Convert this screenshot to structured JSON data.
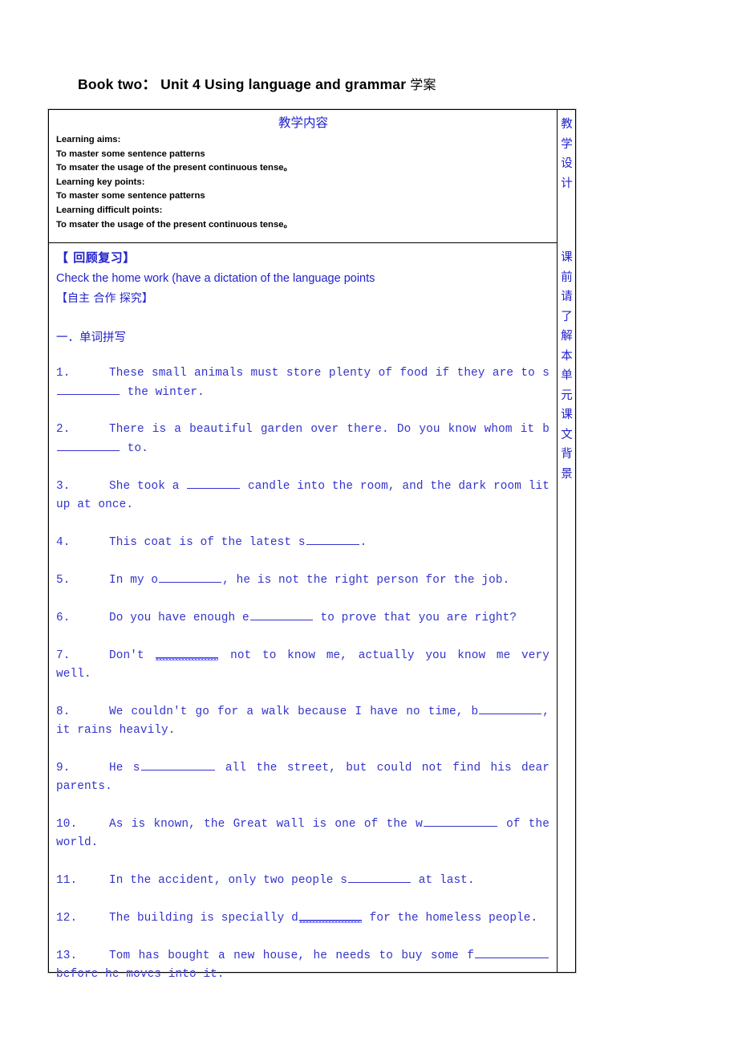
{
  "document": {
    "title_en": "Book two： Unit 4   Using language and grammar ",
    "title_cn": "学案"
  },
  "table": {
    "header_cell": {
      "heading": "教学内容",
      "lines": [
        "Learning aims:",
        "To master some sentence patterns",
        "To msater the usage of the present continuous tense。",
        "Learning key points:",
        "To master some sentence patterns",
        "Learning difficult points:",
        "To msater the usage of the present continuous tense。"
      ]
    },
    "body_cell": {
      "review_heading": "【 回顾复习】",
      "review_task": "Check the home work (have a dictation of the language points",
      "method_bracket": "【自主  合作  探究】",
      "section_heading": "一．单词拼写",
      "items": [
        {
          "num": "1.",
          "parts": [
            {
              "t": "text",
              "v": "These small animals must store plenty of food if they are to s"
            },
            {
              "t": "blank",
              "w": "md"
            },
            {
              "t": "text",
              "v": " the winter."
            }
          ]
        },
        {
          "num": "2.",
          "parts": [
            {
              "t": "text",
              "v": "There is a beautiful garden over there. Do you know whom it b"
            },
            {
              "t": "blank",
              "w": "md"
            },
            {
              "t": "text",
              "v": " to."
            }
          ]
        },
        {
          "num": "3.",
          "parts": [
            {
              "t": "text",
              "v": "She took a "
            },
            {
              "t": "blank",
              "w": "sm"
            },
            {
              "t": "text",
              "v": " candle into the room, and the dark room lit up at once."
            }
          ]
        },
        {
          "num": "4.",
          "parts": [
            {
              "t": "text",
              "v": "This coat is of the latest s"
            },
            {
              "t": "blank",
              "w": "sm"
            },
            {
              "t": "text",
              "v": "."
            }
          ]
        },
        {
          "num": "5.",
          "parts": [
            {
              "t": "text",
              "v": "In my o"
            },
            {
              "t": "blank",
              "w": "md"
            },
            {
              "t": "text",
              "v": ", he is not the right person for the job."
            }
          ]
        },
        {
          "num": "6.",
          "parts": [
            {
              "t": "text",
              "v": "Do you have enough e"
            },
            {
              "t": "blank",
              "w": "md"
            },
            {
              "t": "text",
              "v": " to prove that you are right?"
            }
          ]
        },
        {
          "num": "7.",
          "parts": [
            {
              "t": "text",
              "v": "Don't "
            },
            {
              "t": "squiggle"
            },
            {
              "t": "text",
              "v": " not to know me, actually you know me very well."
            }
          ]
        },
        {
          "num": "8.",
          "parts": [
            {
              "t": "text",
              "v": "We couldn't go for a walk because I have no time, b"
            },
            {
              "t": "blank",
              "w": "md"
            },
            {
              "t": "text",
              "v": ", it rains heavily."
            }
          ]
        },
        {
          "num": "9.",
          "parts": [
            {
              "t": "text",
              "v": "He s"
            },
            {
              "t": "blank",
              "w": "lg"
            },
            {
              "t": "text",
              "v": " all the street, but could not find his dear parents."
            }
          ]
        },
        {
          "num": "10.",
          "parts": [
            {
              "t": "text",
              "v": "As is known, the Great wall is one of the w"
            },
            {
              "t": "blank",
              "w": "lg"
            },
            {
              "t": "text",
              "v": " of the world."
            }
          ]
        },
        {
          "num": "11.",
          "parts": [
            {
              "t": "text",
              "v": "In the accident, only two people s"
            },
            {
              "t": "blank",
              "w": "md"
            },
            {
              "t": "text",
              "v": " at last."
            }
          ]
        },
        {
          "num": "12.",
          "parts": [
            {
              "t": "text",
              "v": "The building is specially d"
            },
            {
              "t": "squiggle"
            },
            {
              "t": "text",
              "v": " for the homeless people."
            }
          ]
        },
        {
          "num": "13.",
          "parts": [
            {
              "t": "text",
              "v": "Tom has bought a new house, he needs to buy some f"
            },
            {
              "t": "blank",
              "w": "lg"
            },
            {
              "t": "text",
              "v": " before he moves into it."
            }
          ]
        }
      ]
    },
    "notes_column": {
      "header_label": "教学设计",
      "body_label": "课前请了解本单元课文背景"
    }
  },
  "colors": {
    "text_blue": "#3333CC",
    "heading_blue": "#2222CC",
    "border": "#000000"
  }
}
